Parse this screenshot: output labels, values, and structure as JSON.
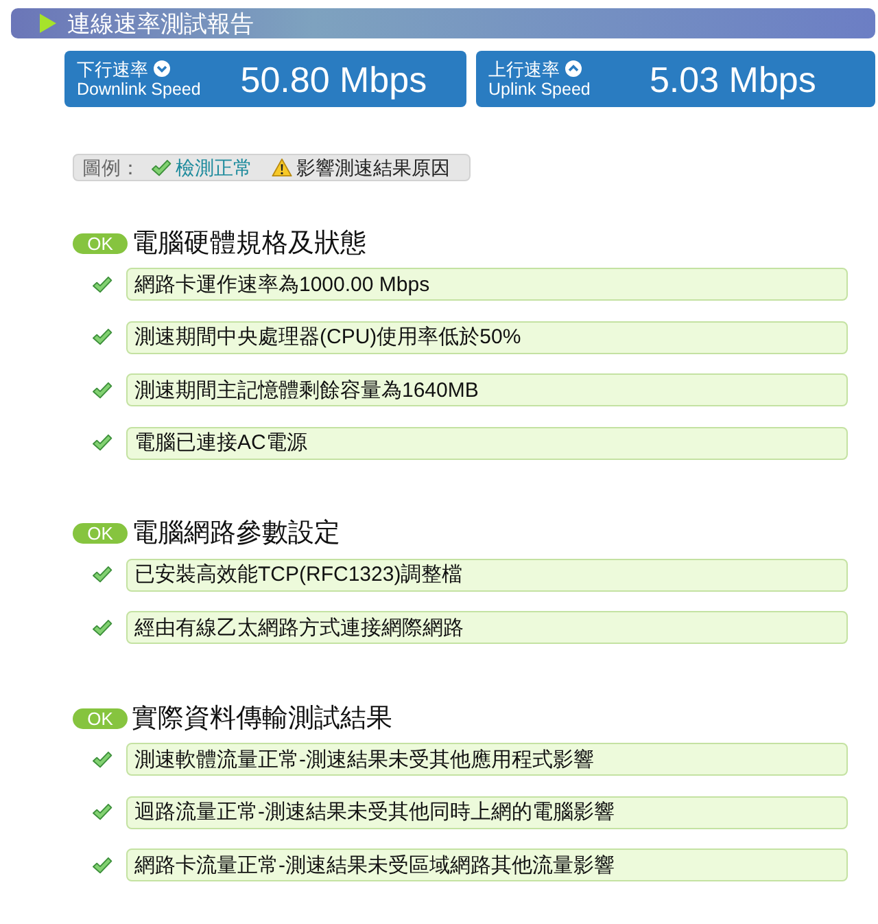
{
  "report": {
    "title": "連線速率測試報告"
  },
  "speeds": [
    {
      "kind": "down",
      "label": "下行速率",
      "label_en": "Downlink Speed",
      "value": "50.80 Mbps"
    },
    {
      "kind": "up",
      "label": "上行速率",
      "label_en": "Uplink Speed",
      "value": "5.03 Mbps"
    }
  ],
  "legend": {
    "label": "圖例：",
    "items": [
      {
        "kind": "ok",
        "text": "檢測正常"
      },
      {
        "kind": "warning",
        "text": "影響測速結果原因"
      }
    ]
  },
  "sections": [
    {
      "badge": "OK",
      "title": "電腦硬體規格及狀態",
      "items": [
        {
          "kind": "ok",
          "text": "網路卡運作速率為1000.00 Mbps"
        },
        {
          "kind": "ok",
          "text": "測速期間中央處理器(CPU)使用率低於50%"
        },
        {
          "kind": "ok",
          "text": "測速期間主記憶體剩餘容量為1640MB"
        },
        {
          "kind": "ok",
          "text": "電腦已連接AC電源"
        }
      ]
    },
    {
      "badge": "OK",
      "title": "電腦網路參數設定",
      "items": [
        {
          "kind": "ok",
          "text": "已安裝高效能TCP(RFC1323)調整檔"
        },
        {
          "kind": "ok",
          "text": "經由有線乙太網路方式連接網際網路"
        }
      ]
    },
    {
      "badge": "OK",
      "title": "實際資料傳輸測試結果",
      "items": [
        {
          "kind": "ok",
          "text": "測速軟體流量正常-測速結果未受其他應用程式影響"
        },
        {
          "kind": "ok",
          "text": "迴路流量正常-測速結果未受其他同時上網的電腦影響"
        },
        {
          "kind": "ok",
          "text": "網路卡流量正常-測速結果未受區域網路其他流量影響"
        }
      ]
    }
  ]
}
